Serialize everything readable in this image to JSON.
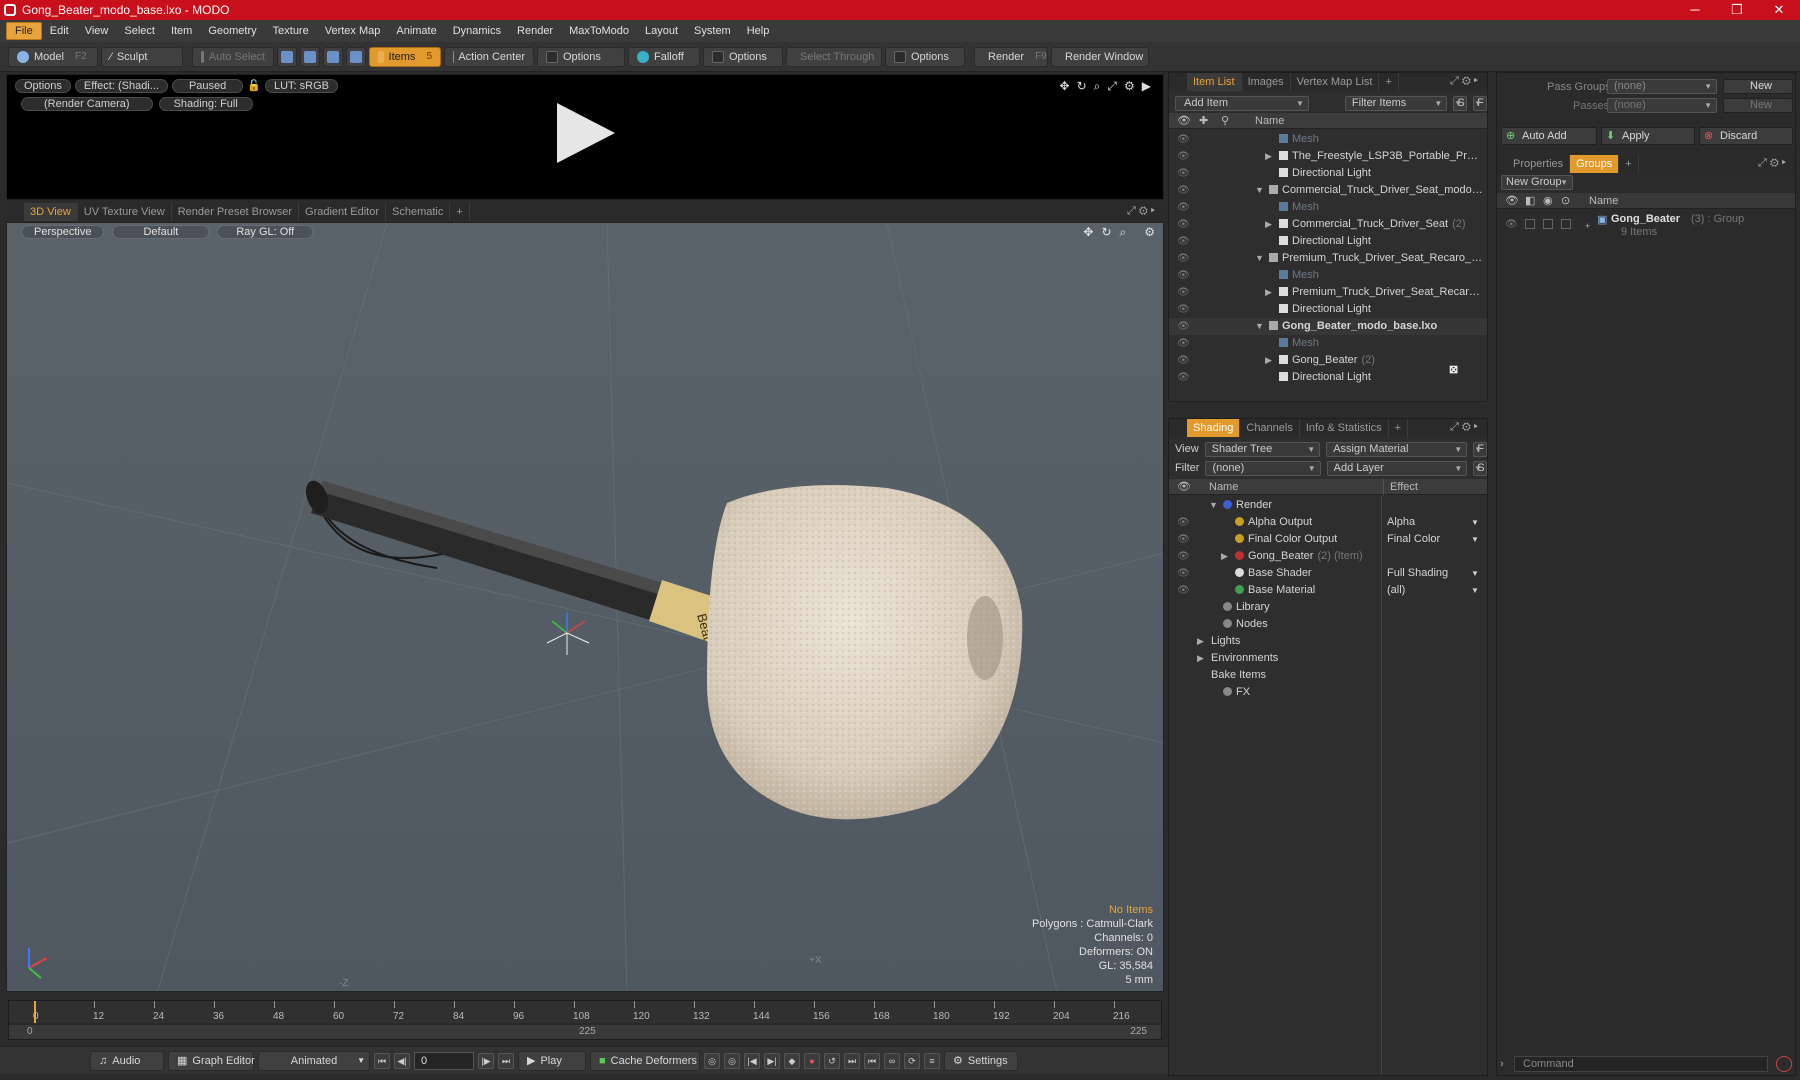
{
  "window": {
    "title": "Gong_Beater_modo_base.lxo - MODO",
    "minimize": "─",
    "maximize": "❐",
    "close": "✕"
  },
  "menu": [
    "File",
    "Edit",
    "View",
    "Select",
    "Item",
    "Geometry",
    "Texture",
    "Vertex Map",
    "Animate",
    "Dynamics",
    "Render",
    "MaxToModo",
    "Layout",
    "System",
    "Help"
  ],
  "toolbar": {
    "model": "Model",
    "model_key": "F2",
    "sculpt": "Sculpt",
    "auto_select": "Auto Select",
    "items": "Items",
    "items_key": "5",
    "action_center": "Action Center",
    "options1": "Options",
    "falloff": "Falloff",
    "options2": "Options",
    "select_through": "Select Through",
    "options3": "Options",
    "render": "Render",
    "render_key": "F9",
    "render_window": "Render Window"
  },
  "preview": {
    "options": "Options",
    "effect": "Effect: (Shadi...",
    "paused": "Paused",
    "lut": "LUT: sRGB",
    "camera": "(Render Camera)",
    "shading": "Shading: Full"
  },
  "view_tabs": [
    "3D View",
    "UV Texture View",
    "Render Preset Browser",
    "Gradient Editor",
    "Schematic",
    "+"
  ],
  "viewport": {
    "perspective": "Perspective",
    "default": "Default",
    "raygl": "Ray GL: Off",
    "axis_x": "+X",
    "axis_z": "-Z"
  },
  "stats": {
    "no_items": "No Items",
    "polygons": "Polygons : Catmull-Clark",
    "channels": "Channels: 0",
    "deformers": "Deformers: ON",
    "gl": "GL: 35,584",
    "unit": "5 mm"
  },
  "timeline": {
    "marks": [
      "0",
      "12",
      "24",
      "36",
      "48",
      "60",
      "72",
      "84",
      "96",
      "108",
      "120",
      "132",
      "144",
      "156",
      "168",
      "180",
      "192",
      "204",
      "216"
    ],
    "start": "0",
    "mid": "225",
    "end": "225"
  },
  "bottombar": {
    "audio": "Audio",
    "graph_editor": "Graph Editor",
    "animated": "Animated",
    "frame": "0",
    "play": "Play",
    "cache": "Cache Deformers",
    "settings": "Settings"
  },
  "item_list": {
    "tabs": [
      "Item List",
      "Images",
      "Vertex Map List",
      "+"
    ],
    "add_item": "Add Item",
    "filter": "Filter Items",
    "s": "S",
    "f": "F",
    "col_name": "Name",
    "rows": [
      {
        "label": "Mesh",
        "dim": true,
        "indent": 4,
        "arrow": ""
      },
      {
        "label": "The_Freestyle_LSP3B_Portable_Proje ...",
        "dim": false,
        "indent": 4,
        "arrow": "▶"
      },
      {
        "label": "Directional Light",
        "dim": false,
        "indent": 4,
        "arrow": ""
      },
      {
        "label": "Commercial_Truck_Driver_Seat_modo_b ...",
        "dim": false,
        "indent": 3,
        "arrow": "▼"
      },
      {
        "label": "Mesh",
        "dim": true,
        "indent": 4,
        "arrow": ""
      },
      {
        "label": "Commercial_Truck_Driver_Seat",
        "count": "(2)",
        "dim": false,
        "indent": 4,
        "arrow": "▶"
      },
      {
        "label": "Directional Light",
        "dim": false,
        "indent": 4,
        "arrow": ""
      },
      {
        "label": "Premium_Truck_Driver_Seat_Recaro_C_...",
        "dim": false,
        "indent": 3,
        "arrow": "▼"
      },
      {
        "label": "Mesh",
        "dim": true,
        "indent": 4,
        "arrow": ""
      },
      {
        "label": "Premium_Truck_Driver_Seat_Recaro_ ...",
        "dim": false,
        "indent": 4,
        "arrow": "▶"
      },
      {
        "label": "Directional Light",
        "dim": false,
        "indent": 4,
        "arrow": ""
      },
      {
        "label": "Gong_Beater_modo_base.lxo",
        "dim": false,
        "bold": true,
        "indent": 3,
        "arrow": "▼"
      },
      {
        "label": "Mesh",
        "dim": true,
        "indent": 4,
        "arrow": ""
      },
      {
        "label": "Gong_Beater",
        "count": "(2)",
        "dim": false,
        "indent": 4,
        "arrow": "▶"
      },
      {
        "label": "Directional Light",
        "dim": false,
        "indent": 4,
        "arrow": ""
      }
    ]
  },
  "shading": {
    "tabs": [
      "Shading",
      "Channels",
      "Info & Statistics",
      "+"
    ],
    "view_label": "View",
    "view_value": "Shader Tree",
    "assign": "Assign Material",
    "filter_label": "Filter",
    "filter_value": "(none)",
    "add_layer": "Add Layer",
    "f": "F",
    "s": "S",
    "col_name": "Name",
    "col_effect": "Effect",
    "rows": [
      {
        "label": "Render",
        "effect": "",
        "indent": 1,
        "arrow": "▼",
        "icon": "#3a5fd8",
        "eye": false
      },
      {
        "label": "Alpha Output",
        "effect": "Alpha",
        "indent": 2,
        "arrow": "",
        "icon": "#c8a020",
        "eye": true
      },
      {
        "label": "Final Color Output",
        "effect": "Final Color",
        "indent": 2,
        "arrow": "",
        "icon": "#c8a020",
        "eye": true
      },
      {
        "label": "Gong_Beater",
        "count": "(2) (Item)",
        "effect": "",
        "indent": 2,
        "arrow": "▶",
        "icon": "#c03030",
        "eye": true
      },
      {
        "label": "Base Shader",
        "effect": "Full Shading",
        "indent": 2,
        "arrow": "",
        "icon": "#dddddd",
        "eye": true
      },
      {
        "label": "Base Material",
        "effect": "(all)",
        "indent": 2,
        "arrow": "",
        "icon": "#40a050",
        "eye": true
      },
      {
        "label": "Library",
        "effect": "",
        "indent": 1,
        "arrow": "",
        "icon": "#888888",
        "eye": false
      },
      {
        "label": "Nodes",
        "effect": "",
        "indent": 1,
        "arrow": "",
        "icon": "#888888",
        "eye": false
      },
      {
        "label": "Lights",
        "effect": "",
        "indent": 0,
        "arrow": "▶",
        "icon": "",
        "eye": false
      },
      {
        "label": "Environments",
        "effect": "",
        "indent": 0,
        "arrow": "▶",
        "icon": "",
        "eye": false
      },
      {
        "label": "Bake Items",
        "effect": "",
        "indent": 0,
        "arrow": "",
        "icon": "",
        "eye": false
      },
      {
        "label": "FX",
        "effect": "",
        "indent": 1,
        "arrow": "",
        "icon": "#888888",
        "eye": false
      }
    ]
  },
  "groups": {
    "pass_groups": "Pass Groups",
    "pass_groups_val": "(none)",
    "new": "New",
    "passes": "Passes",
    "passes_val": "(none)",
    "new2": "New",
    "auto_add": "Auto Add",
    "apply": "Apply",
    "discard": "Discard",
    "tabs": [
      "Properties",
      "Groups",
      "+"
    ],
    "new_group": "New Group",
    "col_name": "Name",
    "group_name": "Gong_Beater",
    "group_count": "(3) : Group",
    "group_items": "9 Items"
  },
  "command": "Command"
}
